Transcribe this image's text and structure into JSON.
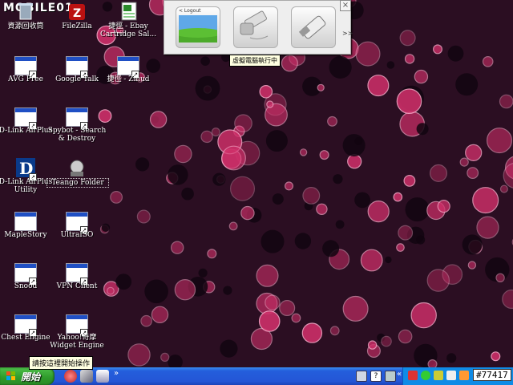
{
  "watermark": {
    "logo_text": "MOBILE01",
    "id_text": "#77417"
  },
  "desktop_icons": [
    {
      "id": "recycle",
      "label": "資源回收筒",
      "icon": "recycle-bin-icon"
    },
    {
      "id": "filezilla",
      "label": "FileZilla",
      "icon": "filezilla-icon"
    },
    {
      "id": "ebay",
      "label": "捷徑 - Ebay Cartridge Sal...",
      "icon": "excel-shortcut-icon"
    },
    {
      "id": "avg",
      "label": "AVG Free",
      "icon": "app-window-icon"
    },
    {
      "id": "gtalk",
      "label": "Google Talk",
      "icon": "app-window-icon"
    },
    {
      "id": "zmud",
      "label": "捷徑 - Zmud",
      "icon": "app-window-icon"
    },
    {
      "id": "dlink",
      "label": "D-Link AirPlus",
      "icon": "app-window-icon"
    },
    {
      "id": "spybot",
      "label": "Spybot - Search & Destroy",
      "icon": "app-window-icon"
    },
    {
      "id": "dlinkutil",
      "label": "D-Link AirPlus Utility",
      "icon": "dlink-icon"
    },
    {
      "id": "teango",
      "label": "Teango Folder",
      "icon": "teango-folder-icon"
    },
    {
      "id": "maple",
      "label": "MapleStory",
      "icon": "app-window-icon"
    },
    {
      "id": "ultraiso",
      "label": "UltraISO",
      "icon": "app-window-icon"
    },
    {
      "id": "snood",
      "label": "Snood",
      "icon": "app-window-icon"
    },
    {
      "id": "vpn",
      "label": "VPN Client",
      "icon": "app-window-icon"
    },
    {
      "id": "chess",
      "label": "Chest Engine",
      "icon": "app-window-icon"
    },
    {
      "id": "yahoo",
      "label": "Yahoo!奇摩 Widget Engine",
      "icon": "app-window-icon"
    }
  ],
  "launcher": {
    "logout_label": "< Logout",
    "more_label": ">>",
    "close_label": "×",
    "items": [
      {
        "icon": "desktop-landscape-icon"
      },
      {
        "icon": "usb-drive-icon"
      },
      {
        "icon": "usb-key-icon"
      }
    ],
    "tooltip": "虛擬電腦執行中"
  },
  "tooltip_start": "請按這裡開始操作",
  "taskbar": {
    "start_label": "開始",
    "quicklaunch_more": "»",
    "tray_more": "«",
    "quicklaunch": [
      "browser-icon",
      "network-icon",
      "media-icon"
    ],
    "tray_icons": [
      "monitor-icon",
      "help-icon",
      "network-tray-icon",
      "antivirus-icon",
      "messenger-icon",
      "security-icon",
      "speaker-icon"
    ]
  },
  "colors": {
    "accent": "#245edc",
    "start": "#3aa834",
    "wallpaper": "#2b0e22",
    "bubble": "#d0306a"
  }
}
